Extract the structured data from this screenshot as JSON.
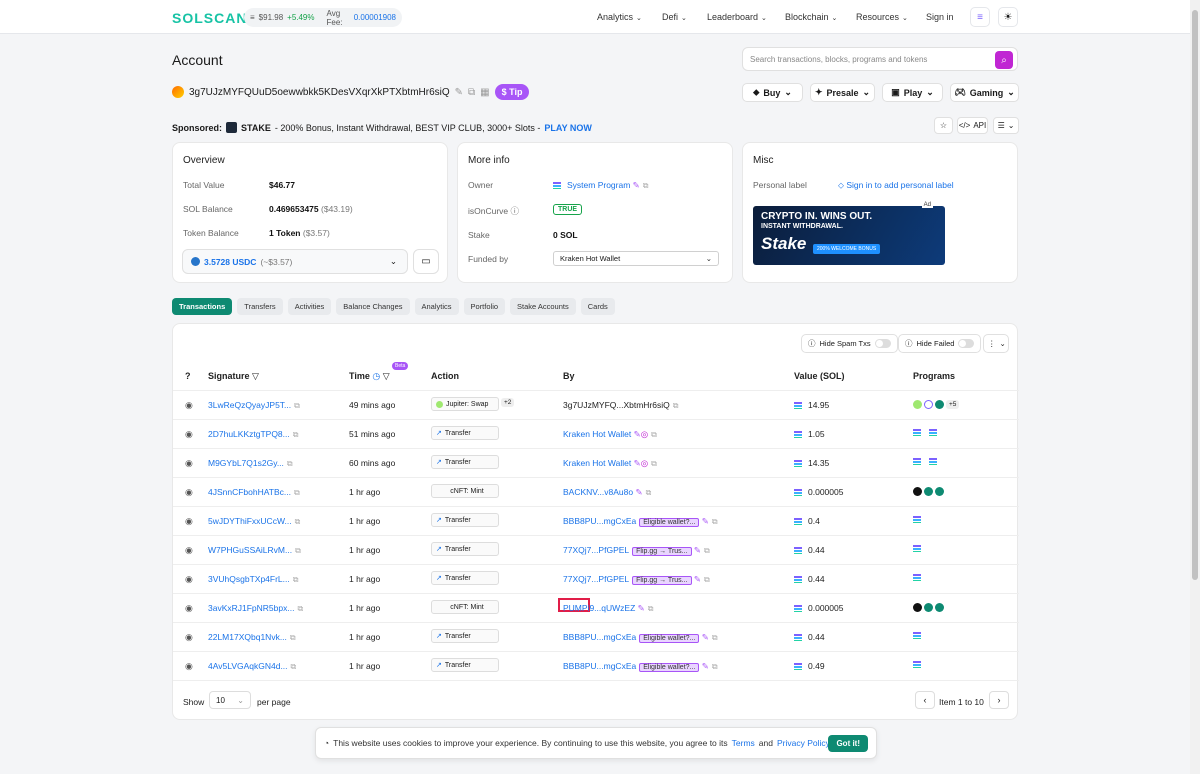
{
  "header": {
    "logo": "SOLSCAN",
    "price": "$91.98",
    "price_change": "+5.49%",
    "fee_label": "Avg Fee:",
    "fee_value": "0.00001908",
    "nav": [
      "Analytics",
      "Defi",
      "Leaderboard",
      "Blockchain",
      "Resources"
    ],
    "sign_in": "Sign in"
  },
  "page": {
    "title": "Account",
    "search_placeholder": "Search transactions, blocks, programs and tokens",
    "address": "3g7UJzMYFQUuD5oewwbkk5KDesVXqrXkPTXbtmHr6siQ",
    "tip_label": "Tip",
    "dropdowns": [
      "Buy",
      "Presale",
      "Play",
      "Gaming"
    ]
  },
  "sponsored": {
    "label": "Sponsored:",
    "brand": "STAKE",
    "text": " - 200% Bonus, Instant Withdrawal, BEST VIP CLUB, 3000+ Slots - ",
    "cta": "PLAY NOW",
    "api_label": "API"
  },
  "overview": {
    "title": "Overview",
    "total_value_label": "Total Value",
    "total_value": "$46.77",
    "sol_balance_label": "SOL Balance",
    "sol_balance": "0.469653475",
    "sol_balance_usd": "($43.19)",
    "token_balance_label": "Token Balance",
    "token_balance": "1 Token",
    "token_balance_usd": "($3.57)",
    "usdc_amount": "3.5728 USDC",
    "usdc_usd": "(~$3.57)"
  },
  "more_info": {
    "title": "More info",
    "owner_label": "Owner",
    "owner_value": "System Program",
    "oncurve_label": "isOnCurve",
    "oncurve_value": "TRUE",
    "stake_label": "Stake",
    "stake_value": "0 SOL",
    "funded_label": "Funded by",
    "funded_value": "Kraken Hot Wallet"
  },
  "misc": {
    "title": "Misc",
    "personal_label": "Personal label",
    "sign_in_label": "Sign in to add personal label",
    "ad_headline": "CRYPTO IN. WINS OUT.",
    "ad_sub": "INSTANT WITHDRAWAL.",
    "ad_logo": "Stake",
    "ad_bonus": "200% WELCOME BONUS",
    "ad_tag": "Ad"
  },
  "tabs": [
    "Transactions",
    "Transfers",
    "Activities",
    "Balance Changes",
    "Analytics",
    "Portfolio",
    "Stake Accounts",
    "Cards"
  ],
  "table": {
    "hide_spam": "Hide Spam Txs",
    "hide_failed": "Hide Failed",
    "beta": "Beta",
    "columns": [
      "Signature",
      "Time",
      "Action",
      "By",
      "Value (SOL)",
      "Programs"
    ],
    "rows": [
      {
        "sig": "3LwReQzQyayJP5T...",
        "time": "49 mins ago",
        "action": "Jupiter: Swap",
        "by": "3g7UJzMYFQ...XbtmHr6siQ",
        "flag": "",
        "value": "14.95"
      },
      {
        "sig": "2D7huLKKztgTPQ8...",
        "time": "51 mins ago",
        "action": "Transfer",
        "by": "Kraken Hot Wallet",
        "flag": "",
        "value": "1.05"
      },
      {
        "sig": "M9GYbL7Q1s2Gy...",
        "time": "60 mins ago",
        "action": "Transfer",
        "by": "Kraken Hot Wallet",
        "flag": "",
        "value": "14.35"
      },
      {
        "sig": "4JSnnCFbohHATBc...",
        "time": "1 hr ago",
        "action": "cNFT: Mint",
        "by": "BACKNV...v8Au8o",
        "flag": "",
        "value": "0.000005"
      },
      {
        "sig": "5wJDYThiFxxUCcW...",
        "time": "1 hr ago",
        "action": "Transfer",
        "by": "BBB8PU...mgCxEa",
        "flag": "Eligible wallet?...",
        "value": "0.4"
      },
      {
        "sig": "W7PHGuSSAiLRvM...",
        "time": "1 hr ago",
        "action": "Transfer",
        "by": "77XQj7...PfGPEL",
        "flag": "Flip.gg → Trus...",
        "value": "0.44"
      },
      {
        "sig": "3VUhQsgbTXp4FrL...",
        "time": "1 hr ago",
        "action": "Transfer",
        "by": "77XQj7...PfGPEL",
        "flag": "Flip.gg → Trus...",
        "value": "0.44"
      },
      {
        "sig": "3avKxRJ1FpNR5bpx...",
        "time": "1 hr ago",
        "action": "cNFT: Mint",
        "by": "PUMPi9...qUWzEZ",
        "flag": "",
        "value": "0.000005"
      },
      {
        "sig": "22LM17XQbq1Nvk...",
        "time": "1 hr ago",
        "action": "Transfer",
        "by": "BBB8PU...mgCxEa",
        "flag": "Eligible wallet?...",
        "value": "0.44"
      },
      {
        "sig": "4Av5LVGAqkGN4d...",
        "time": "1 hr ago",
        "action": "Transfer",
        "by": "BBB8PU...mgCxEa",
        "flag": "Eligible wallet?...",
        "value": "0.49"
      }
    ],
    "show_label": "Show",
    "per_page_value": "10",
    "per_page_label": "per page",
    "page_info": "Item 1 to 10"
  },
  "cookie": {
    "text": "This website uses cookies to improve your experience. By continuing to use this website, you agree to its",
    "terms": "Terms",
    "and": "and",
    "policy": "Privacy Policy.",
    "button": "Got it!"
  }
}
